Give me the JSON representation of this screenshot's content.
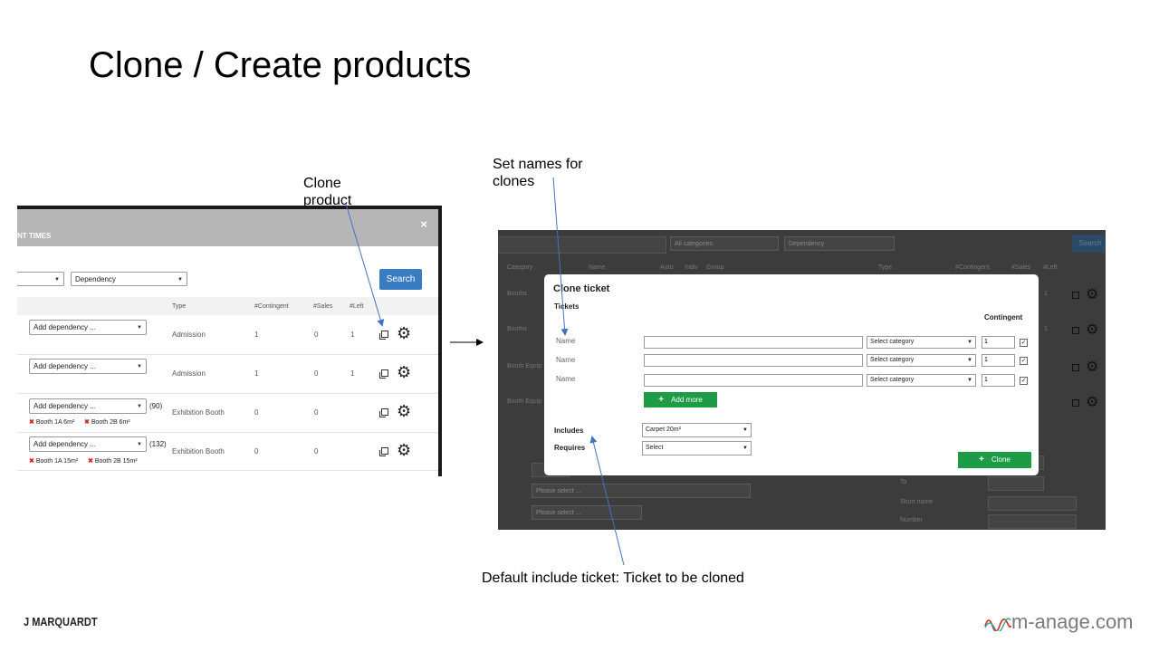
{
  "slide": {
    "title": "Clone / Create products",
    "callouts": {
      "clone_product": "Clone product",
      "set_names": "Set names for clones",
      "default_include": "Default include ticket: Ticket to be cloned"
    }
  },
  "left_screen": {
    "header_text": "NT TIMES",
    "close_label": "×",
    "filter_select_value": "",
    "dependency_select": "Dependency",
    "search_label": "Search",
    "columns": [
      "Type",
      "#Contingent",
      "#Sales",
      "#Left"
    ],
    "rows": [
      {
        "dependency": "Add dependency ...",
        "count": "",
        "type": "Admission",
        "contingent": "1",
        "sales": "0",
        "left": "1",
        "tags": []
      },
      {
        "dependency": "Add dependency ...",
        "count": "",
        "type": "Admission",
        "contingent": "1",
        "sales": "0",
        "left": "1",
        "tags": []
      },
      {
        "dependency": "Add dependency ...",
        "count": "(90)",
        "type": "Exhibition Booth",
        "contingent": "0",
        "sales": "0",
        "left": "",
        "tags": [
          "Booth 1A 6m²",
          "Booth 2B 6m²"
        ]
      },
      {
        "dependency": "Add dependency ...",
        "count": "(132)",
        "type": "Exhibition Booth",
        "contingent": "0",
        "sales": "0",
        "left": "",
        "tags": [
          "Booth 1A 15m²",
          "Booth 2B 15m²"
        ]
      }
    ],
    "icons": {
      "clone": "copy-icon",
      "settings": "gear-icon",
      "remove": "x-icon"
    }
  },
  "right_screen": {
    "background": {
      "category_filter": "All categories",
      "dependency_filter": "Dependency",
      "search_label": "Search",
      "columns": [
        "Category",
        "Name",
        "Auto",
        "Indiv",
        "Group",
        "Type",
        "#Contingent",
        "#Sales",
        "#Left"
      ],
      "row_categories": [
        "Booths",
        "Booths",
        "Booth Equip",
        "Booth Equip"
      ],
      "row_values": [
        "1",
        "1",
        "",
        ""
      ],
      "lower_selects": [
        "Please select ...",
        "Please select ..."
      ],
      "lower_labels": [
        "To",
        "Short name",
        "Number"
      ]
    },
    "modal": {
      "title": "Clone ticket",
      "section": "Tickets",
      "contingent_header": "Contingent",
      "rows": [
        {
          "label": "Name",
          "name_value": "",
          "category": "Select category",
          "contingent": "1",
          "checked": true
        },
        {
          "label": "Name",
          "name_value": "",
          "category": "Select category",
          "contingent": "1",
          "checked": true
        },
        {
          "label": "Name",
          "name_value": "",
          "category": "Select category",
          "contingent": "1",
          "checked": true
        }
      ],
      "add_more_label": "Add more",
      "includes_label": "Includes",
      "includes_value": "Carpet 20m²",
      "requires_label": "Requires",
      "requires_value": "Select",
      "clone_label": "Clone"
    }
  },
  "logos": {
    "left": "J MARQUARDT",
    "right": "m-anage.com"
  },
  "colors": {
    "search_blue": "#3a7cc2",
    "action_green": "#1e9b45",
    "remove_red": "#d9261c",
    "arrow_blue": "#4472c4"
  }
}
